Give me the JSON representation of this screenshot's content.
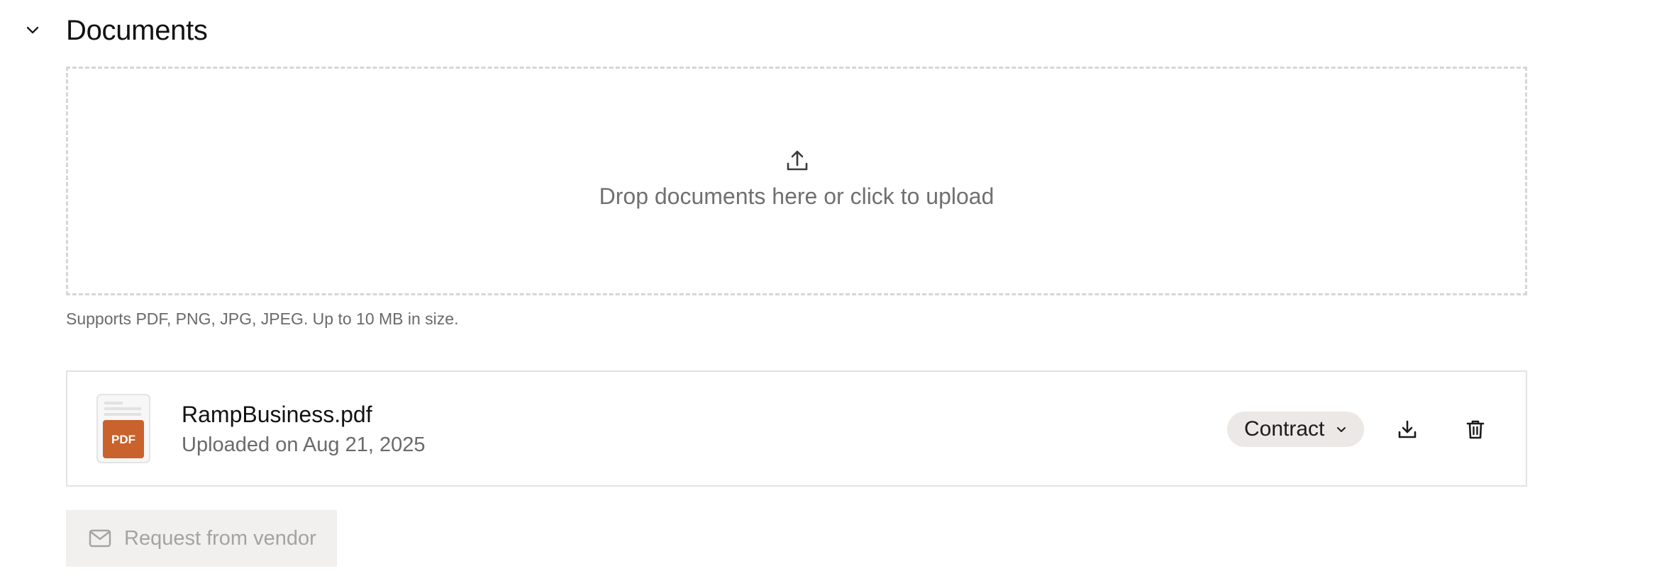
{
  "section": {
    "title": "Documents",
    "toggle_icon": "chevron-down-icon"
  },
  "upload": {
    "icon": "upload-icon",
    "label": "Drop documents here or click to upload",
    "support_note": "Supports PDF, PNG, JPG, JPEG. Up to 10 MB in size."
  },
  "files": [
    {
      "thumbnail_badge": "PDF",
      "thumbnail_color": "#c9622c",
      "name": "RampBusiness.pdf",
      "meta": "Uploaded on Aug 21, 2025",
      "type_selected": "Contract",
      "actions": [
        "download-icon",
        "trash-icon"
      ]
    }
  ],
  "request_button": {
    "icon": "mail-icon",
    "label": "Request from vendor",
    "disabled": true
  },
  "colors": {
    "pill_background": "#ebe8e5",
    "dashed_border": "#d6d6d6",
    "muted_text": "#6a6a6a"
  }
}
